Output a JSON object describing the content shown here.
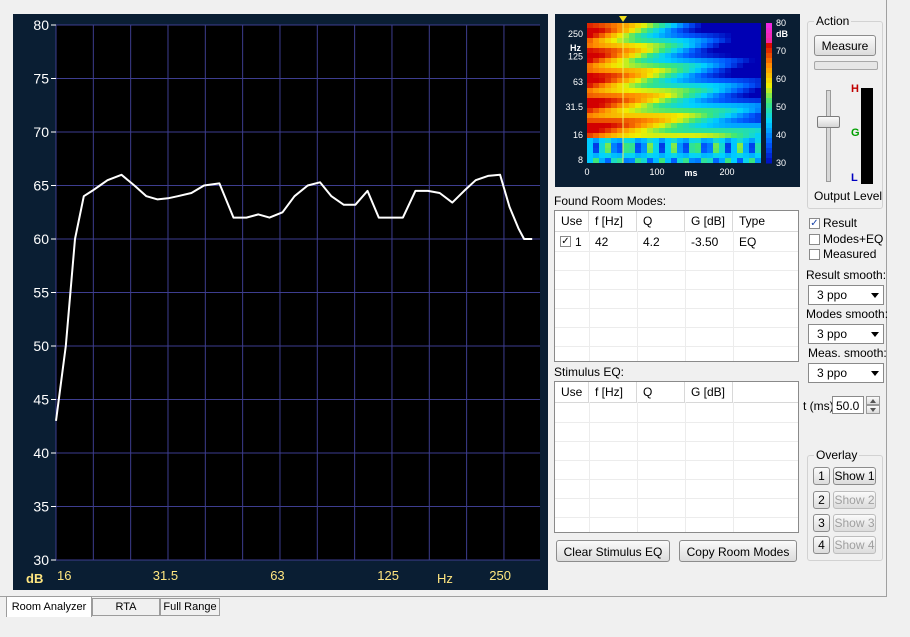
{
  "main_plot": {
    "y_ticks": [
      "80",
      "75",
      "70",
      "65",
      "60",
      "55",
      "50",
      "45",
      "40",
      "35",
      "30"
    ],
    "x_ticks": [
      "16",
      "31.5",
      "63",
      "125",
      "250"
    ],
    "x_unit": "Hz",
    "y_unit": "dB",
    "bg_color": "#0a1e33",
    "plot_color": "#000000",
    "grid_color": "#3d3d8f",
    "curve_color": "#ffffff"
  },
  "chart_data": {
    "type": "line",
    "x_scale": "log",
    "xlim": [
      16,
      320
    ],
    "ylim": [
      30,
      80
    ],
    "x_tick_labels": [
      "16",
      "31.5",
      "63",
      "125",
      "250"
    ],
    "y_tick_labels": [
      "30",
      "35",
      "40",
      "45",
      "50",
      "55",
      "60",
      "65",
      "70",
      "75",
      "80"
    ],
    "series": [
      {
        "x": [
          16,
          17,
          18,
          19,
          20,
          21,
          22,
          24,
          26,
          28,
          30,
          32,
          34,
          37,
          40,
          44,
          48,
          52,
          56,
          60,
          65,
          70,
          76,
          82,
          88,
          95,
          102,
          110,
          118,
          127,
          137,
          148,
          160,
          172,
          186,
          200,
          215,
          232,
          250,
          265,
          280,
          290,
          300,
          305
        ],
        "y": [
          43,
          50,
          60,
          64,
          64.5,
          65,
          65.5,
          66,
          65,
          64,
          63.7,
          63.8,
          64,
          64.3,
          65,
          65.2,
          62,
          62,
          62.3,
          62,
          62.5,
          64,
          65,
          65.3,
          64,
          63.2,
          63.2,
          64.5,
          62,
          62,
          62,
          64.5,
          64.5,
          64.3,
          63.4,
          64.5,
          65.5,
          65.9,
          66,
          63,
          61,
          60,
          60,
          60
        ]
      }
    ]
  },
  "spectrogram": {
    "y_ticks": [
      "250",
      "125",
      "63",
      "31.5",
      "16",
      "8"
    ],
    "y_unit": "Hz",
    "x_ticks": [
      "0",
      "100",
      "200"
    ],
    "x_unit": "ms",
    "colorbar_ticks": [
      "80",
      "70",
      "60",
      "50",
      "40",
      "30"
    ],
    "colorbar_unit": "dB"
  },
  "action": {
    "title": "Action",
    "measure_label": "Measure",
    "output_level_label": "Output Level",
    "meter_h": "H",
    "meter_g": "G",
    "meter_l": "L"
  },
  "found_modes": {
    "title": "Found Room Modes:",
    "headers": [
      "Use",
      "f [Hz]",
      "Q",
      "G [dB]",
      "Type"
    ],
    "rows": [
      {
        "use": "1",
        "f": "42",
        "q": "4.2",
        "g": "-3.50",
        "type": "EQ",
        "checked": true
      }
    ]
  },
  "stimulus_eq": {
    "title": "Stimulus EQ:",
    "headers": [
      "Use",
      "f [Hz]",
      "Q",
      "G [dB]"
    ]
  },
  "options": {
    "result_label": "Result",
    "modes_eq_label": "Modes+EQ",
    "measured_label": "Measured",
    "result_smooth_label": "Result smooth:",
    "result_smooth_value": "3 ppo",
    "modes_smooth_label": "Modes smooth:",
    "modes_smooth_value": "3 ppo",
    "meas_smooth_label": "Meas. smooth:",
    "meas_smooth_value": "3 ppo",
    "t_label": "t (ms)",
    "t_value": "50.0"
  },
  "overlay": {
    "title": "Overlay",
    "items": [
      {
        "num": "1",
        "label": "Show 1"
      },
      {
        "num": "2",
        "label": "Show 2"
      },
      {
        "num": "3",
        "label": "Show 3"
      },
      {
        "num": "4",
        "label": "Show 4"
      }
    ]
  },
  "buttons": {
    "clear_stimulus_eq": "Clear Stimulus EQ",
    "copy_room_modes": "Copy Room Modes"
  },
  "tabs": [
    "Room Analyzer",
    "RTA",
    "Full Range"
  ]
}
